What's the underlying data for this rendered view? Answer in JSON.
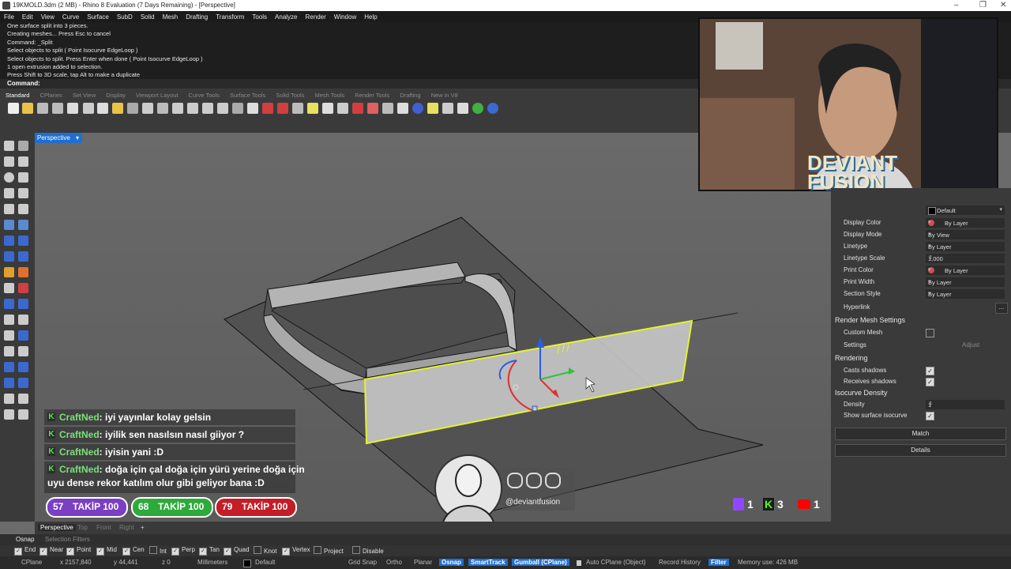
{
  "window": {
    "title": "19KMOLD.3dm (2 MB) - Rhino 8 Evaluation (7 Days Remaining) - [Perspective]",
    "controls": [
      "–",
      "❐",
      "✕"
    ]
  },
  "menu": [
    "File",
    "Edit",
    "View",
    "Curve",
    "Surface",
    "SubD",
    "Solid",
    "Mesh",
    "Drafting",
    "Transform",
    "Tools",
    "Analyze",
    "Render",
    "Window",
    "Help"
  ],
  "command_history": [
    "One surface split into 3 pieces.",
    "Creating meshes... Press Esc to cancel",
    "Command: _Split",
    "Select objects to split ( Point  Isocurve  EdgeLoop )",
    "Select objects to split. Press Enter when done ( Point  Isocurve  EdgeLoop )",
    "1 open extrusion added to selection.",
    "Press Shift to 3D scale, tap Alt to make a duplicate"
  ],
  "command_prompt": "Command:",
  "toolbar_tabs": [
    "Standard",
    "CPlanes",
    "Set View",
    "Display",
    "Viewport Layout",
    "Curve Tools",
    "Surface Tools",
    "Solid Tools",
    "Mesh Tools",
    "Render Tools",
    "Drafting",
    "New in V8"
  ],
  "viewport": {
    "title": "Perspective",
    "menu_arrow": "▾"
  },
  "properties": {
    "material_value": "Default",
    "rows": [
      {
        "label": "Display Color",
        "value": "By Layer",
        "swatch": "#d05050"
      },
      {
        "label": "Display Mode",
        "value": "By View"
      },
      {
        "label": "Linetype",
        "value": "By Layer"
      },
      {
        "label": "Linetype Scale",
        "value": "1,000"
      },
      {
        "label": "Print Color",
        "value": "By Layer",
        "swatch": "#d05050"
      },
      {
        "label": "Print Width",
        "value": "By Layer"
      },
      {
        "label": "Section Style",
        "value": "By Layer"
      }
    ],
    "hyperlink_label": "Hyperlink",
    "hyperlink_btn": "...",
    "render_mesh_title": "Render Mesh Settings",
    "custom_mesh_label": "Custom Mesh",
    "settings_label": "Settings",
    "adjust_label": "Adjust",
    "rendering_title": "Rendering",
    "casts_label": "Casts shadows",
    "receives_label": "Receives shadows",
    "isocurve_title": "Isocurve Density",
    "density_label": "Density",
    "density_value": "1",
    "show_iso_label": "Show surface isocurve",
    "match_label": "Match",
    "details_label": "Details"
  },
  "viewport_tabs": [
    "Perspective",
    "Top",
    "Front",
    "Right",
    "+"
  ],
  "osnap_tabs": [
    "Osnap",
    "Selection Filters"
  ],
  "osnaps": [
    {
      "label": "End",
      "on": true
    },
    {
      "label": "Near",
      "on": true
    },
    {
      "label": "Point",
      "on": true
    },
    {
      "label": "Mid",
      "on": true
    },
    {
      "label": "Cen",
      "on": true
    },
    {
      "label": "Int",
      "on": false
    },
    {
      "label": "Perp",
      "on": true
    },
    {
      "label": "Tan",
      "on": true
    },
    {
      "label": "Quad",
      "on": true
    },
    {
      "label": "Knot",
      "on": false
    },
    {
      "label": "Vertex",
      "on": true
    },
    {
      "label": "Project",
      "on": false
    },
    {
      "label": "Disable",
      "on": false
    }
  ],
  "status": {
    "cplane": "CPlane",
    "x": "x 2157,840",
    "y": "y 44,441",
    "z": "z 0",
    "units": "Millimeters",
    "layer": "Default",
    "grid_snap": "Grid Snap",
    "ortho": "Ortho",
    "planar": "Planar",
    "osnap": "Osnap",
    "smarttrack": "SmartTrack",
    "gumball": "Gumball (CPlane)",
    "auto_cplane": "Auto CPlane (Object)",
    "record_history": "Record History",
    "filter": "Filter",
    "memory": "Memory use: 426 MB"
  },
  "chat": [
    {
      "user": "CraftNed",
      "text": ": iyi yayınlar kolay gelsin"
    },
    {
      "user": "CraftNed",
      "text": ": iyilik sen nasılsın nasıl giiyor ?"
    },
    {
      "user": "CraftNed",
      "text": ": iyisin yani :D"
    },
    {
      "user": "CraftNed",
      "text": ": doğa için çal doğa için yürü yerine doğa için",
      "cont": "uyu dense rekor katılım olur gibi geliyor bana :D"
    }
  ],
  "follow_pills": [
    {
      "count": "57",
      "label": "TAKİP 100",
      "color": "#7a3fc4"
    },
    {
      "count": "68",
      "label": "TAKİP 100",
      "color": "#2eaa3a"
    },
    {
      "count": "79",
      "label": "TAKİP 100",
      "color": "#c41d27"
    }
  ],
  "social_handle": "@deviantfusion",
  "brand": "DEVIANT FUSION",
  "platform_counts": [
    {
      "icon": "twitch-icon",
      "count": "1",
      "color": "#9147ff"
    },
    {
      "icon": "kick-icon",
      "count": "3",
      "color": "#53fc18"
    },
    {
      "icon": "youtube-icon",
      "count": "1",
      "color": "#ff0000"
    }
  ]
}
